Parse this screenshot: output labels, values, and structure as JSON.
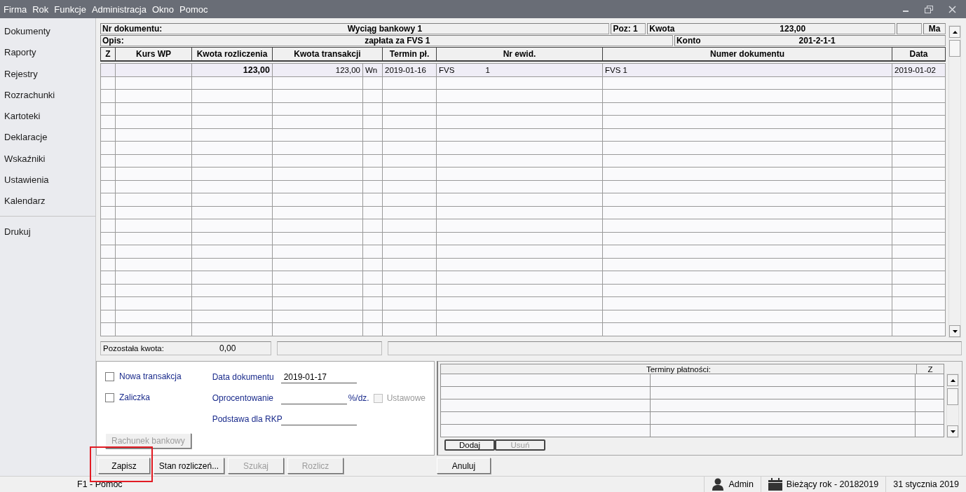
{
  "menu": [
    "Firma",
    "Rok",
    "Funkcje",
    "Administracja",
    "Okno",
    "Pomoc"
  ],
  "sidebar": {
    "items": [
      "Dokumenty",
      "Raporty",
      "Rejestry",
      "Rozrachunki",
      "Kartoteki",
      "Deklaracje",
      "Wskaźniki",
      "Ustawienia",
      "Kalendarz"
    ],
    "bottom_items": [
      "Drukuj"
    ]
  },
  "document": {
    "number_label": "Nr dokumentu:",
    "number": "Wyciąg bankowy 1",
    "position": "Poz: 1",
    "amount_label": "Kwota",
    "amount": "123,00",
    "side": "Ma",
    "description_label": "Opis:",
    "description": "zapłata za FVS 1",
    "account_label": "Konto",
    "account": "201-2-1-1"
  },
  "table": {
    "columns": [
      "Z",
      "Kurs WP",
      "Kwota rozliczenia",
      "Kwota transakcji",
      "Termin pł.",
      "Nr ewid.",
      "Numer dokumentu",
      "Data"
    ],
    "rows": [
      {
        "settlement_amount": "123,00",
        "transaction_amount": "123,00",
        "side": "Wn",
        "due_date": "2019-01-16",
        "register_type": "FVS",
        "register_number": "1",
        "document_number": "FVS 1",
        "date": "2019-01-02",
        "selected": true
      }
    ]
  },
  "summary": {
    "remaining_label": "Pozostała kwota:",
    "remaining": "0,00"
  },
  "options": {
    "checkboxes": [
      {
        "label": "Nowa transakcja",
        "checked": false
      },
      {
        "label": "Zaliczka",
        "checked": false
      }
    ],
    "fields": [
      {
        "label": "Data dokumentu",
        "value": "2019-01-17"
      },
      {
        "label": "Oprocentowanie",
        "unit": "%/dz.",
        "checkbox": {
          "label": "Ustawowe",
          "checked": false,
          "disabled": true
        }
      },
      {
        "label": "Podstawa dla RKP"
      }
    ],
    "bank_button": {
      "label": "Rachunek bankowy",
      "disabled": true
    }
  },
  "payment_terms": {
    "title": "Terminy płatności:",
    "z_column": "Z",
    "buttons": [
      {
        "label": "Dodaj",
        "disabled": false
      },
      {
        "label": "Usuń",
        "disabled": true
      }
    ]
  },
  "actions": [
    {
      "label": "Zapisz",
      "disabled": false,
      "highlighted": true
    },
    {
      "label": "Stan rozliczeń...",
      "disabled": false,
      "highlighted": false
    },
    {
      "label": "Szukaj",
      "disabled": true,
      "highlighted": false
    },
    {
      "label": "Rozlicz",
      "disabled": true,
      "highlighted": false
    }
  ],
  "cancel": {
    "label": "Anuluj",
    "disabled": false
  },
  "status_bar": {
    "help": "F1 - Pomoc",
    "user": "Admin",
    "year": "Bieżący rok - 20182019",
    "date": "31 stycznia 2019"
  }
}
